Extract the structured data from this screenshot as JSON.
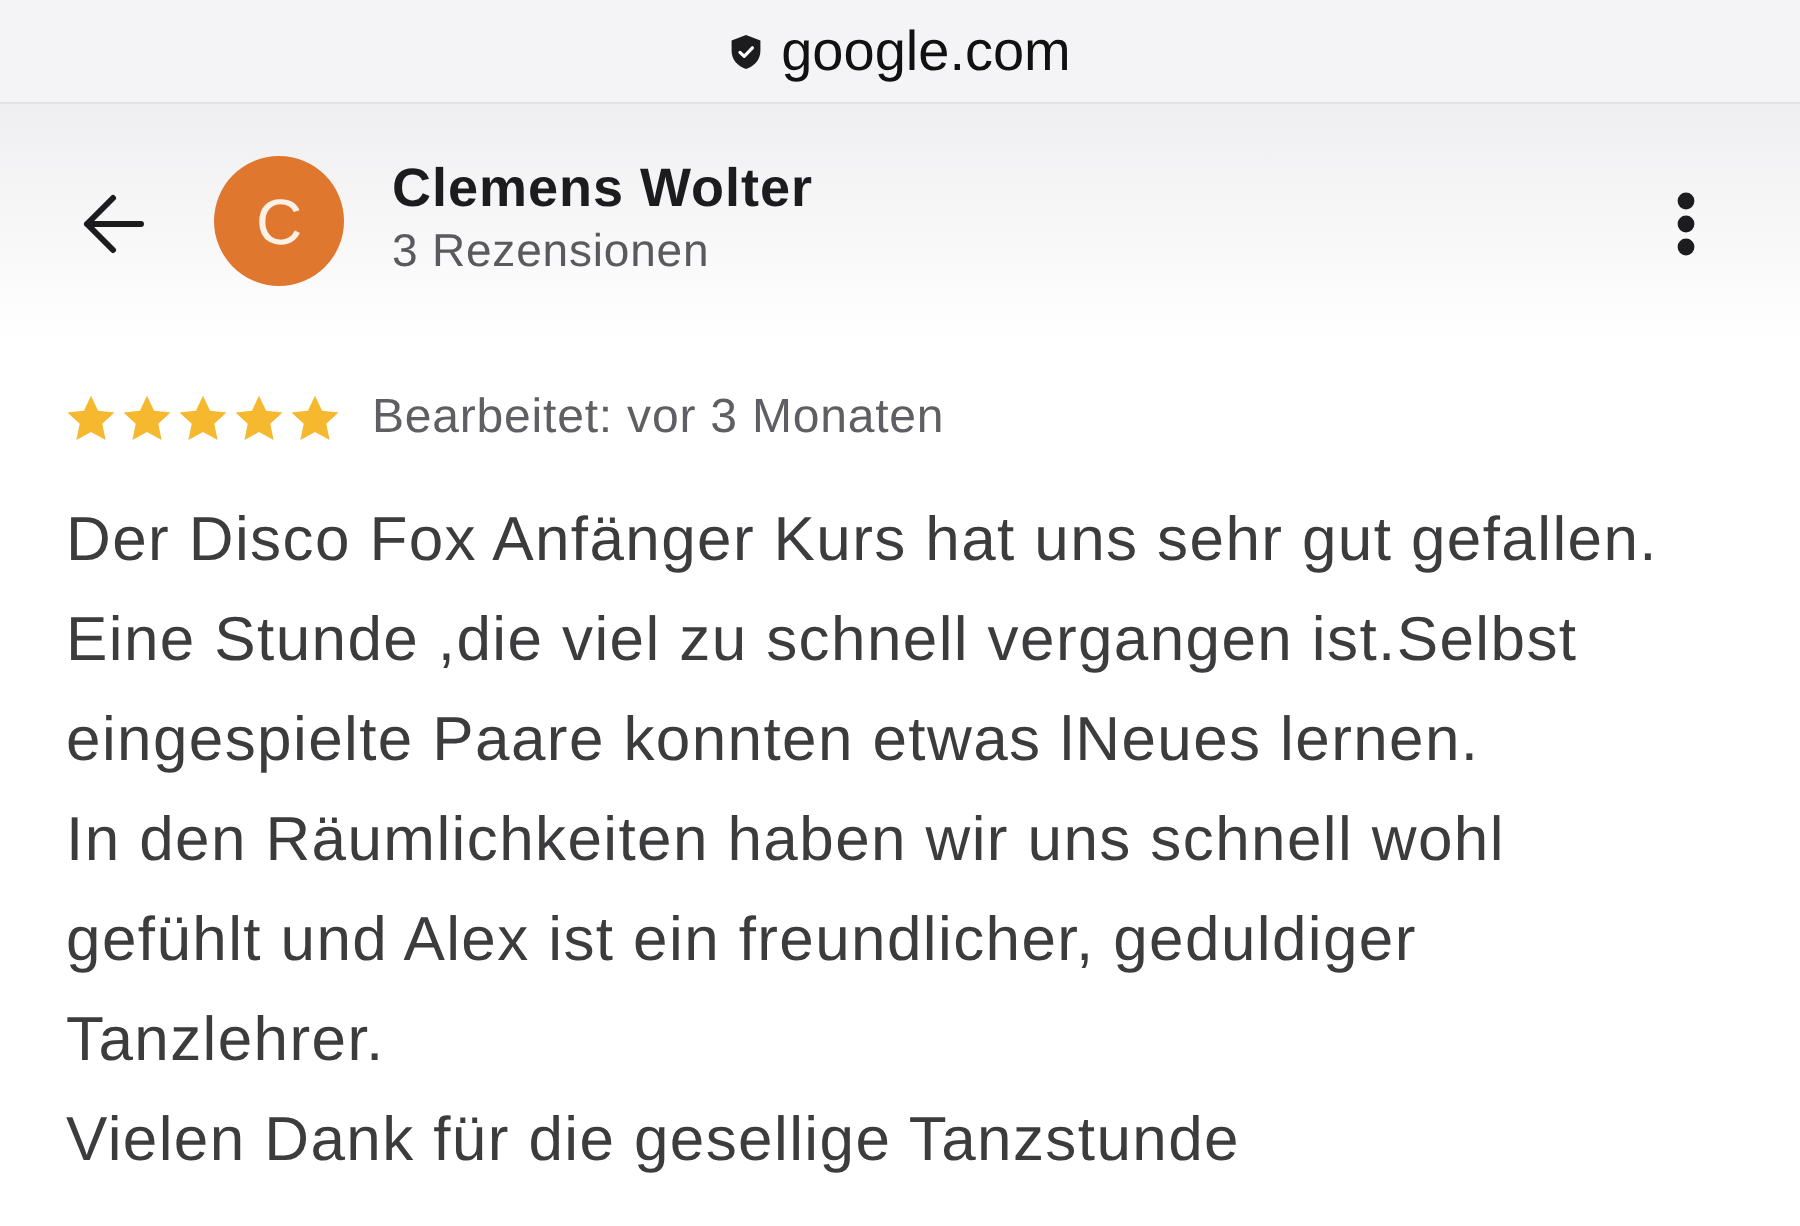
{
  "address_bar": {
    "domain": "google.com"
  },
  "reviewer": {
    "initial": "C",
    "name": "Clemens Wolter",
    "review_count": "3 Rezensionen"
  },
  "review": {
    "stars": 5,
    "edited": "Bearbeitet: vor 3 Monaten",
    "paragraphs": [
      "Der Disco Fox Anfänger Kurs hat uns sehr gut gefallen. Eine Stunde ,die viel zu schnell vergangen ist.Selbst eingespielte Paare konnten etwas lNeues lernen.",
      "In den Räumlichkeiten haben wir uns schnell wohl gefühlt und Alex ist ein freundlicher, geduldiger Tanzlehrer.",
      "Vielen Dank für die gesellige Tanzstunde"
    ]
  }
}
